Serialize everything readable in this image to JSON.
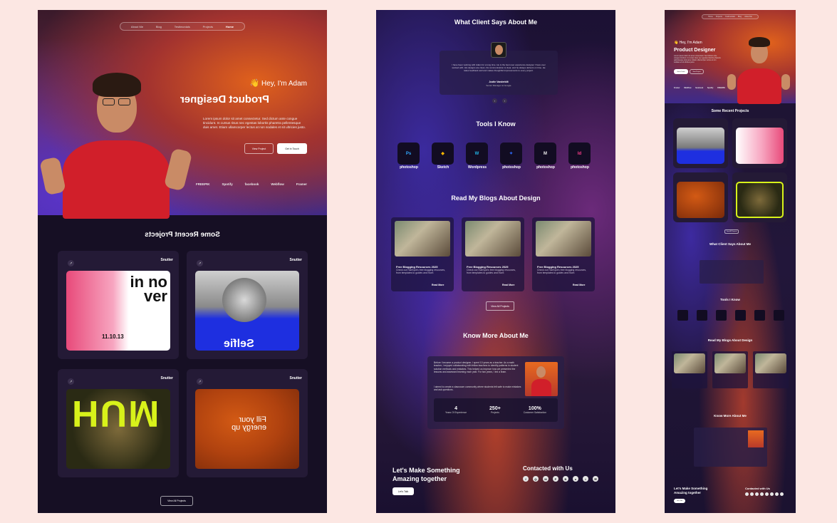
{
  "nav": {
    "items": [
      "Home",
      "Projects",
      "Testimonials",
      "Blog",
      "About Me"
    ]
  },
  "hero": {
    "greeting": "Hey, I'm Adam",
    "wave_icon": "waving-hand-icon",
    "role": "Product Designer",
    "description": "Lorem ipsum dolor sit amet consectetur. Sed dictum ante congue tincidunt. In cursus risus nec egestas lobortis pharetra pellentesque duis amet. Etiam ullamcorper lectus at non sodales et sit ultricies justo.",
    "primary_button": "Get in Touch",
    "secondary_button": "View Project"
  },
  "logos": [
    "Framer",
    "Webflow",
    "facebook",
    "Spotify",
    "FREEPIK"
  ],
  "projects": {
    "title": "Some Recent Projects",
    "card_title": "Snutter",
    "view_all": "View All Projects",
    "art_texts": {
      "innover": "in no ver",
      "innover_date": "11.10.13",
      "selfie": "Selfie",
      "fill": "Fill your energy up",
      "hum": "HUM"
    }
  },
  "testimonial": {
    "title": "What Client Says About Me",
    "quote": "I have been working with Adam for a long time. He is the best user experience designer I have ever worked with. His designs are clean, his communication is clear, and he always delivers on time. He takes feedback well and makes thoughtful improvements to every project.",
    "name": "Justin Vanderbilt",
    "role": "Senior Manager at Google"
  },
  "tools": {
    "title": "Tools I Know",
    "items": [
      {
        "abbr": "Ps",
        "label": "photoshop",
        "color": "#31a8ff"
      },
      {
        "abbr": "◆",
        "label": "Sketch",
        "color": "#f7b500"
      },
      {
        "abbr": "W",
        "label": "Wordpress",
        "color": "#21b6e8"
      },
      {
        "abbr": "✦",
        "label": "photoshop",
        "color": "#2f6bff"
      },
      {
        "abbr": "M",
        "label": "photoshop",
        "color": "#e8e8e8"
      },
      {
        "abbr": "Id",
        "label": "photoshop",
        "color": "#ff3d8b"
      }
    ]
  },
  "blogs": {
    "title": "Read My Blogs About Design",
    "post_title": "Free Blogging Resources 2025",
    "post_desc": "Check out HubSpot's free blogging resources, from templates to guides and more.",
    "read_more": "Read More",
    "view_all": "View All Projects"
  },
  "about": {
    "title": "Know More About Me",
    "para1": "Before I became a product designer, I spent 10 years as a teacher. As a math teacher, I enjoyed collaborating with fellow teachers to identify patterns in student solution methods and mistakes. This helped us improve how we presented the lessons and assessed learning each year. For two years, I led a team.",
    "para2": "I aimed to create a classroom community where students felt safe to make mistakes and ask questions.",
    "stats": [
      {
        "value": "4",
        "label": "Years Of Experience"
      },
      {
        "value": "250+",
        "label": "Projects"
      },
      {
        "value": "100%",
        "label": "Customer Satisfaction"
      }
    ]
  },
  "footer": {
    "cta_line1": "Let's Make Something",
    "cta_line2": "Amazing together",
    "cta_button": "Let's Talk",
    "contact_title": "Contacted with Us",
    "social_icons": [
      "facebook-icon",
      "instagram-icon",
      "medium-icon",
      "pinterest-icon",
      "behance-icon",
      "dribbble-icon",
      "twitter-icon",
      "mail-icon"
    ]
  },
  "colors": {
    "accent_red": "#d11f2a",
    "orange": "#e0611c",
    "purple": "#3d2a8a",
    "dark": "#160f24"
  }
}
